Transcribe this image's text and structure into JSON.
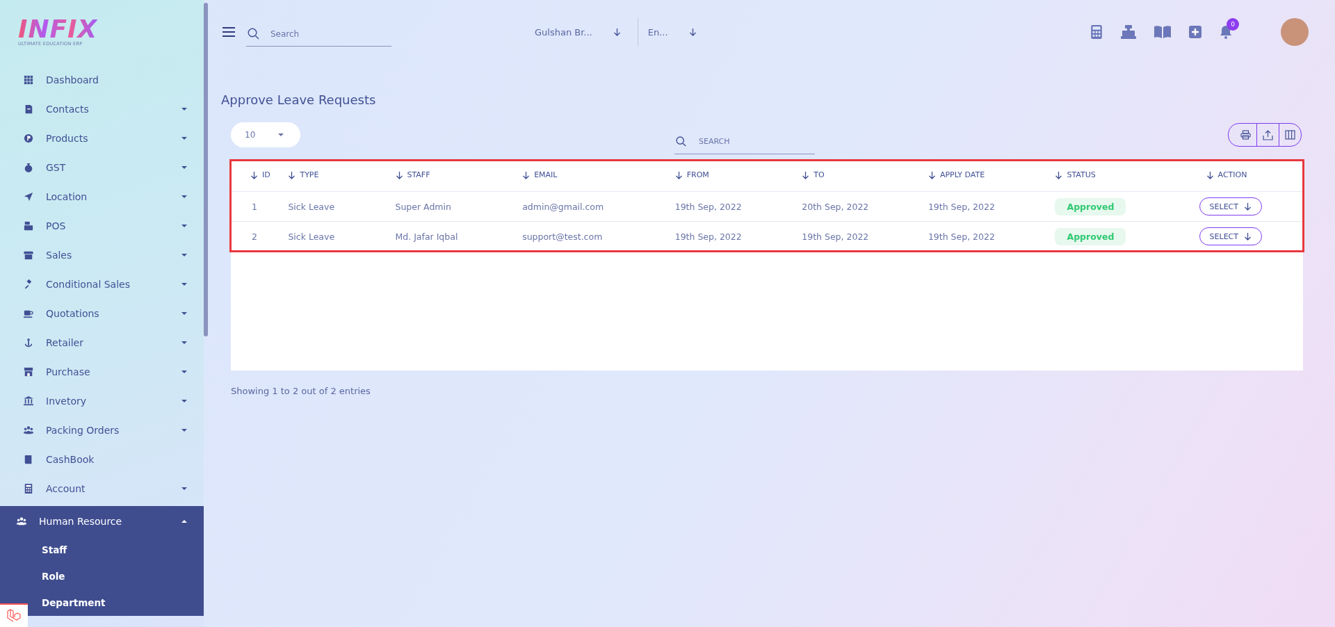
{
  "logo": {
    "wordmark": "INFIX",
    "tagline": "ULTIMATE EDUCATION ERP"
  },
  "sidebar": {
    "items": [
      {
        "label": "Dashboard",
        "has_submenu": false,
        "selected": false
      },
      {
        "label": "Contacts",
        "has_submenu": true,
        "expanded": false,
        "selected": false
      },
      {
        "label": "Products",
        "has_submenu": true,
        "expanded": false,
        "selected": false
      },
      {
        "label": "GST",
        "has_submenu": true,
        "expanded": false,
        "selected": false
      },
      {
        "label": "Location",
        "has_submenu": true,
        "expanded": false,
        "selected": false
      },
      {
        "label": "POS",
        "has_submenu": true,
        "expanded": false,
        "selected": false
      },
      {
        "label": "Sales",
        "has_submenu": true,
        "expanded": false,
        "selected": false
      },
      {
        "label": "Conditional Sales",
        "has_submenu": true,
        "expanded": false,
        "selected": false
      },
      {
        "label": "Quotations",
        "has_submenu": true,
        "expanded": false,
        "selected": false
      },
      {
        "label": "Retailer",
        "has_submenu": true,
        "expanded": false,
        "selected": false
      },
      {
        "label": "Purchase",
        "has_submenu": true,
        "expanded": false,
        "selected": false
      },
      {
        "label": "Invetory",
        "has_submenu": true,
        "expanded": false,
        "selected": false
      },
      {
        "label": "Packing Orders",
        "has_submenu": true,
        "expanded": false,
        "selected": false
      },
      {
        "label": "CashBook",
        "has_submenu": false,
        "selected": false
      },
      {
        "label": "Account",
        "has_submenu": true,
        "expanded": false,
        "selected": false
      },
      {
        "label": "Human Resource",
        "has_submenu": true,
        "expanded": true,
        "selected": true,
        "children": [
          {
            "label": "Staff"
          },
          {
            "label": "Role"
          },
          {
            "label": "Department"
          }
        ]
      }
    ]
  },
  "topbar": {
    "search": {
      "placeholder": "Search"
    },
    "branch": "Gulshan Br...",
    "language": "En...",
    "notifications": "0"
  },
  "page": {
    "title": "Approve Leave Requests",
    "page_size": "10",
    "table_search": {
      "placeholder": "SEARCH"
    },
    "table": {
      "columns": [
        "ID",
        "TYPE",
        "STAFF",
        "EMAIL",
        "FROM",
        "TO",
        "APPLY DATE",
        "STATUS",
        "ACTION"
      ],
      "rows": [
        {
          "id": "1",
          "type": "Sick Leave",
          "staff": "Super Admin",
          "email": "admin@gmail.com",
          "from": "19th Sep, 2022",
          "to": "20th Sep, 2022",
          "apply_date": "19th Sep, 2022",
          "status": "Approved",
          "action": "SELECT"
        },
        {
          "id": "2",
          "type": "Sick Leave",
          "staff": "Md. Jafar Iqbal",
          "email": "support@test.com",
          "from": "19th Sep, 2022",
          "to": "19th Sep, 2022",
          "apply_date": "19th Sep, 2022",
          "status": "Approved",
          "action": "SELECT"
        }
      ]
    },
    "footer": "Showing 1 to 2 out of 2 entries"
  }
}
